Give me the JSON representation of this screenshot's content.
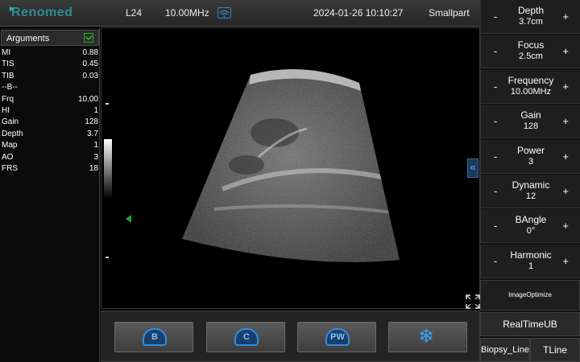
{
  "topbar": {
    "brand": "Renomed",
    "probe": "L24",
    "frequency": "10.00MHz",
    "datetime": "2024-01-26 10:10:27",
    "preset": "Smallpart",
    "wifi_icon": "wifi-icon"
  },
  "arguments": {
    "title": "Arguments",
    "rows": [
      {
        "k": "MI",
        "v": "0.88"
      },
      {
        "k": "TIS",
        "v": "0.45"
      },
      {
        "k": "TIB",
        "v": "0.03"
      },
      {
        "k": "--B--",
        "v": ""
      },
      {
        "k": "Frq",
        "v": "10.00"
      },
      {
        "k": "HI",
        "v": "1"
      },
      {
        "k": "Gain",
        "v": "128"
      },
      {
        "k": "Depth",
        "v": "3.7"
      },
      {
        "k": "Map",
        "v": "1"
      },
      {
        "k": "AO",
        "v": "3"
      },
      {
        "k": "FRS",
        "v": "18"
      }
    ]
  },
  "image": {
    "collapse_label": "«"
  },
  "modes": [
    {
      "label": "B",
      "icon": "b-mode-icon"
    },
    {
      "label": "C",
      "icon": "c-mode-icon"
    },
    {
      "label": "PW",
      "icon": "pw-mode-icon"
    },
    {
      "label": "",
      "icon": "freeze-snowflake-icon"
    }
  ],
  "controls": {
    "minus": "-",
    "plus": "+",
    "items": [
      {
        "name": "Depth",
        "value": "3.7cm"
      },
      {
        "name": "Focus",
        "value": "2.5cm"
      },
      {
        "name": "Frequency",
        "value": "10.00MHz"
      },
      {
        "name": "Gain",
        "value": "128"
      },
      {
        "name": "Power",
        "value": "3"
      },
      {
        "name": "Dynamic",
        "value": "12"
      },
      {
        "name": "BAngle",
        "value": "0°"
      },
      {
        "name": "Harmonic",
        "value": "1"
      }
    ]
  },
  "actions": {
    "image_optimize": "ImageOptimize",
    "realtime": "RealTimeUB",
    "biopsy": "Biopsy_Line",
    "tline": "TLine"
  }
}
